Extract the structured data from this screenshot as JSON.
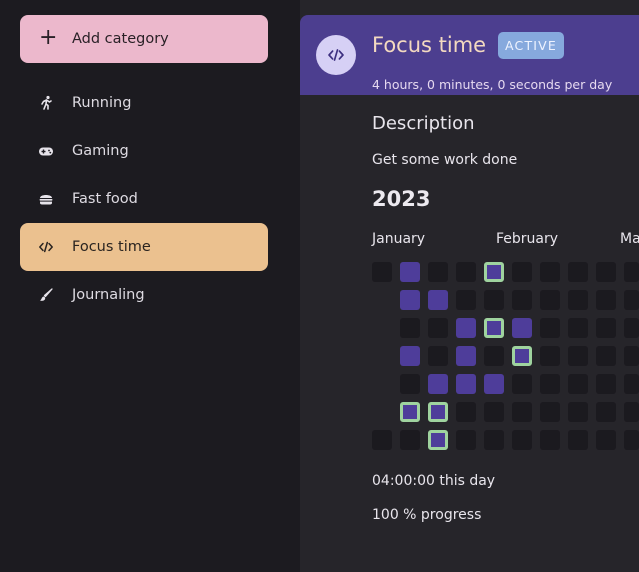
{
  "sidebar": {
    "add_label": "Add category",
    "items": [
      {
        "label": "Running",
        "icon": "running-icon"
      },
      {
        "label": "Gaming",
        "icon": "gamepad-icon"
      },
      {
        "label": "Fast food",
        "icon": "burger-icon"
      },
      {
        "label": "Focus time",
        "icon": "code-icon",
        "active": true
      },
      {
        "label": "Journaling",
        "icon": "brush-icon"
      }
    ]
  },
  "header": {
    "title": "Focus time",
    "badge": "ACTIVE",
    "subtitle": "4 hours, 0 minutes, 0 seconds per day",
    "icon": "code-icon"
  },
  "description": {
    "heading": "Description",
    "text": "Get some work done"
  },
  "calendar": {
    "year": "2023",
    "months": [
      "January",
      "February",
      "Ma"
    ],
    "legend_colors": {
      "active": "#4e3d9a",
      "highlight": "#9fd39f",
      "empty": "#1b1a1f"
    },
    "columns": [
      [
        "empty",
        "none",
        "none",
        "none",
        "none",
        "none",
        "empty"
      ],
      [
        "active",
        "active",
        "empty",
        "active",
        "empty",
        "highlight",
        "empty"
      ],
      [
        "empty",
        "active",
        "empty",
        "empty",
        "active",
        "highlight",
        "highlight"
      ],
      [
        "empty",
        "empty",
        "active",
        "active",
        "active",
        "empty",
        "empty"
      ],
      [
        "highlight",
        "empty",
        "highlight",
        "empty",
        "active",
        "empty",
        "empty"
      ],
      [
        "empty",
        "empty",
        "active",
        "highlight",
        "empty",
        "empty",
        "empty"
      ],
      [
        "empty",
        "empty",
        "empty",
        "empty",
        "empty",
        "empty",
        "empty"
      ],
      [
        "empty",
        "empty",
        "empty",
        "empty",
        "empty",
        "empty",
        "empty"
      ],
      [
        "empty",
        "empty",
        "empty",
        "empty",
        "empty",
        "empty",
        "empty"
      ],
      [
        "empty",
        "empty",
        "empty",
        "empty",
        "empty",
        "empty",
        "empty"
      ]
    ]
  },
  "stats": {
    "today": "04:00:00 this day",
    "progress": "100 % progress",
    "progress_value": 100
  }
}
